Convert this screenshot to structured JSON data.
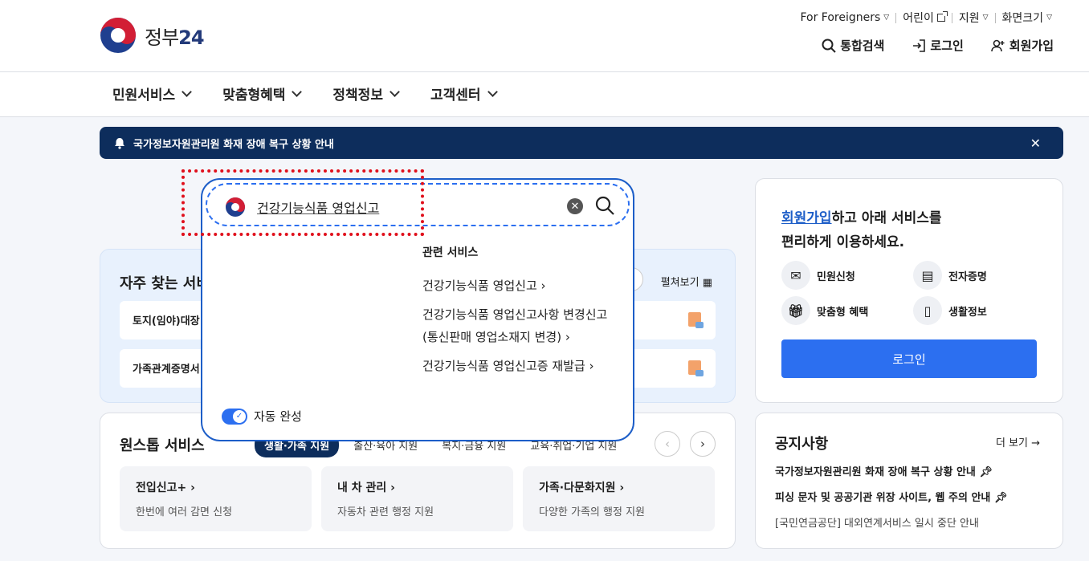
{
  "header": {
    "logo_text": "정부",
    "logo_num": "24",
    "utility": [
      "For Foreigners",
      "어린이",
      "지원",
      "화면크기"
    ],
    "account": [
      "통합검색",
      "로그인",
      "회원가입"
    ]
  },
  "nav": [
    "민원서비스",
    "맞춤형혜택",
    "정책정보",
    "고객센터"
  ],
  "notice_bar": {
    "text": "국가정보자원관리원 화재 장애 복구 상황 안내",
    "close": "✕"
  },
  "frequent": {
    "title": "자주 찾는 서비",
    "expand": "펼쳐보기",
    "cards": [
      "토지(임야)대장",
      "가족관계증명서"
    ]
  },
  "onestop": {
    "title": "원스톱 서비스",
    "tabs": [
      "생활·가족 지원",
      "출산·육아 지원",
      "복지·금융 지원",
      "교육·취업·기업 지원"
    ],
    "cards": [
      {
        "title": "전입신고+",
        "desc": "한번에 여러 감면 신청"
      },
      {
        "title": "내 차 관리",
        "desc": "자동차 관련 행정 지원"
      },
      {
        "title": "가족·다문화지원",
        "desc": "다양한 가족의 행정 지원"
      }
    ]
  },
  "login_panel": {
    "highlight": "회원가입",
    "msg1": "하고 아래 서비스를",
    "msg2": "편리하게 이용하세요.",
    "quick": [
      "민원신청",
      "전자증명",
      "맞춤형 혜택",
      "생활정보"
    ],
    "button": "로그인"
  },
  "notices": {
    "title": "공지사항",
    "more": "더 보기",
    "items": [
      "국가정보자원관리원 화재 장애 복구 상황 안내",
      "피싱 문자 및 공공기관 위장 사이트, 웹 주의 안내",
      "[국민연금공단] 대외연계서비스 일시 중단 안내"
    ]
  },
  "search": {
    "query": "건강기능식품 영업신고",
    "related_head": "관련 서비스",
    "related": [
      "건강기능식품 영업신고",
      "건강기능식품 영업신고사항 변경신고(통신판매 영업소재지 변경)",
      "건강기능식품 영업신고증 재발급"
    ],
    "autocomplete": "자동 완성"
  },
  "colors": {
    "brand_navy": "#0d2d5c",
    "accent_blue": "#2c6ff0",
    "highlight_red": "#e0101c"
  }
}
